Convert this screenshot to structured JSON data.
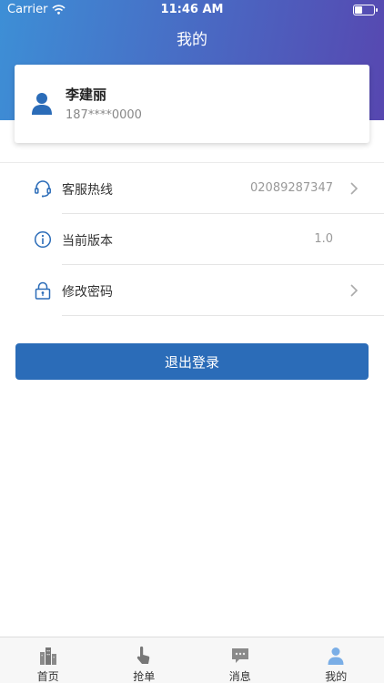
{
  "status_bar": {
    "carrier": "Carrier",
    "time": "11:46 AM",
    "battery_level": 0.4
  },
  "nav": {
    "title": "我的"
  },
  "user": {
    "name": "李建丽",
    "phone": "187****0000"
  },
  "menu": [
    {
      "label": "客服热线",
      "value": "02089287347",
      "icon": "headset-icon",
      "has_chevron": true
    },
    {
      "label": "当前版本",
      "value": "1.0",
      "icon": "info-icon",
      "has_chevron": false
    },
    {
      "label": "修改密码",
      "value": "",
      "icon": "lock-icon",
      "has_chevron": true
    }
  ],
  "logout_label": "退出登录",
  "tabs": [
    {
      "label": "首页",
      "icon": "buildings-icon",
      "active": false
    },
    {
      "label": "抢单",
      "icon": "tap-hand-icon",
      "active": false
    },
    {
      "label": "消息",
      "icon": "message-icon",
      "active": false
    },
    {
      "label": "我的",
      "icon": "person-icon",
      "active": true
    }
  ],
  "colors": {
    "header_gradient_start": "#3d8fd6",
    "header_gradient_end": "#5747b0",
    "primary": "#2b6cb8",
    "tab_active": "#7aaee6",
    "tab_inactive": "#666666"
  }
}
